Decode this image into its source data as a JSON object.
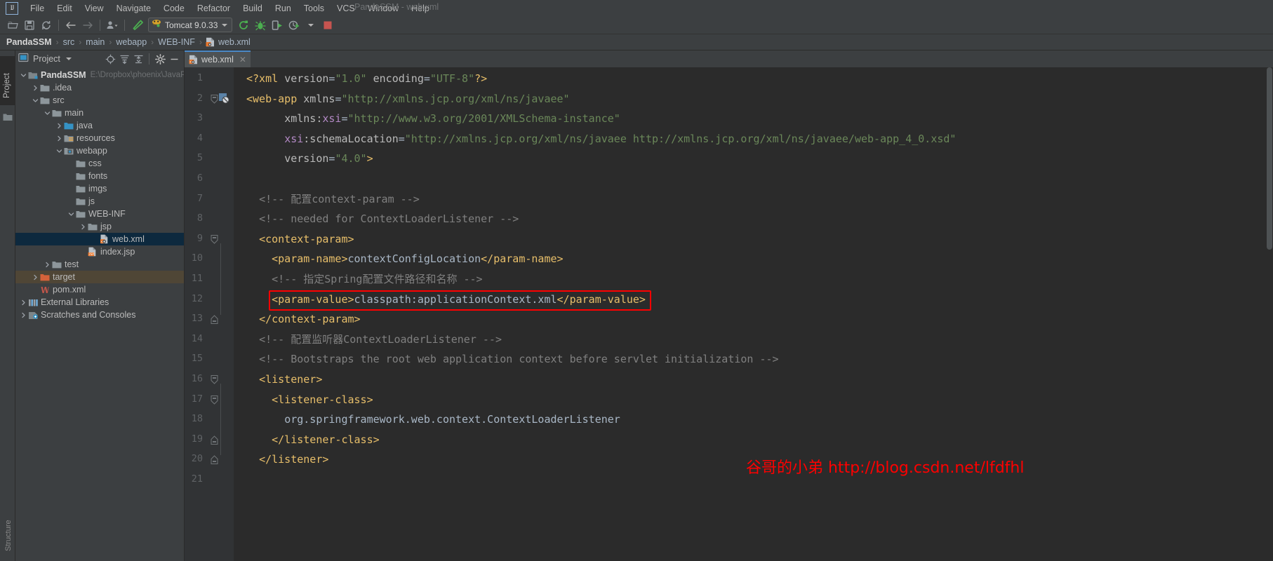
{
  "window": {
    "title": "PandaSSM - web.xml",
    "logo": "IJ"
  },
  "menubar": {
    "items": [
      {
        "label": "File",
        "mnemonic": "F"
      },
      {
        "label": "Edit",
        "mnemonic": "E"
      },
      {
        "label": "View",
        "mnemonic": "V"
      },
      {
        "label": "Navigate",
        "mnemonic": "N"
      },
      {
        "label": "Code",
        "mnemonic": "C"
      },
      {
        "label": "Refactor",
        "mnemonic": "R"
      },
      {
        "label": "Build",
        "mnemonic": "B"
      },
      {
        "label": "Run",
        "mnemonic": "R"
      },
      {
        "label": "Tools",
        "mnemonic": "T"
      },
      {
        "label": "VCS",
        "mnemonic": "V"
      },
      {
        "label": "Window",
        "mnemonic": "W"
      },
      {
        "label": "Help",
        "mnemonic": "H"
      }
    ]
  },
  "toolbar": {
    "open_icon": "open-folder-icon",
    "save_icon": "save-icon",
    "sync_icon": "sync-icon",
    "back_icon": "back-arrow-icon",
    "forward_icon": "forward-arrow-icon",
    "profile_icon": "user-profile-icon",
    "build_icon": "build-hammer-icon",
    "run_config": {
      "label": "Tomcat 9.0.33",
      "icon": "tomcat-icon",
      "dropdown_icon": "chevron-down-icon"
    },
    "rerun_icon": "rerun-icon",
    "debug_icon": "debug-bug-icon",
    "run_with_coverage_icon": "run-coverage-icon",
    "profile_run_icon": "profiler-run-icon",
    "stop_icon": "stop-square-icon"
  },
  "breadcrumb": {
    "items": [
      "PandaSSM",
      "src",
      "main",
      "webapp",
      "WEB-INF",
      "web.xml"
    ],
    "separator": "›"
  },
  "left_strip": {
    "project_tab": "Project",
    "structure_tab": "Structure",
    "favorites_icon": "favorites-folder-icon"
  },
  "project_panel": {
    "title": "Project",
    "title_dropdown_icon": "chevron-down-icon",
    "icons": [
      "locate-target-icon",
      "expand-all-icon",
      "collapse-all-icon",
      "settings-gear-icon",
      "hide-minus-icon"
    ],
    "tree": [
      {
        "label": "PandaSSM",
        "sub": "E:\\Dropbox\\phoenix\\JavaPro",
        "depth": 0,
        "arrow": "down",
        "icon": "module-icon",
        "bold": true,
        "state": "normal"
      },
      {
        "label": ".idea",
        "sub": "",
        "depth": 1,
        "arrow": "right",
        "icon": "folder-icon",
        "bold": false,
        "state": "normal"
      },
      {
        "label": "src",
        "sub": "",
        "depth": 1,
        "arrow": "down",
        "icon": "folder-icon",
        "bold": false,
        "state": "normal"
      },
      {
        "label": "main",
        "sub": "",
        "depth": 2,
        "arrow": "down",
        "icon": "folder-icon",
        "bold": false,
        "state": "normal"
      },
      {
        "label": "java",
        "sub": "",
        "depth": 3,
        "arrow": "right",
        "icon": "source-folder-icon",
        "bold": false,
        "state": "normal"
      },
      {
        "label": "resources",
        "sub": "",
        "depth": 3,
        "arrow": "right",
        "icon": "resources-folder-icon",
        "bold": false,
        "state": "normal"
      },
      {
        "label": "webapp",
        "sub": "",
        "depth": 3,
        "arrow": "down",
        "icon": "webapp-folder-icon",
        "bold": false,
        "state": "normal"
      },
      {
        "label": "css",
        "sub": "",
        "depth": 4,
        "arrow": "none",
        "icon": "folder-icon",
        "bold": false,
        "state": "normal"
      },
      {
        "label": "fonts",
        "sub": "",
        "depth": 4,
        "arrow": "none",
        "icon": "folder-icon",
        "bold": false,
        "state": "normal"
      },
      {
        "label": "imgs",
        "sub": "",
        "depth": 4,
        "arrow": "none",
        "icon": "folder-icon",
        "bold": false,
        "state": "normal"
      },
      {
        "label": "js",
        "sub": "",
        "depth": 4,
        "arrow": "none",
        "icon": "folder-icon",
        "bold": false,
        "state": "normal"
      },
      {
        "label": "WEB-INF",
        "sub": "",
        "depth": 4,
        "arrow": "down",
        "icon": "folder-icon",
        "bold": false,
        "state": "normal"
      },
      {
        "label": "jsp",
        "sub": "",
        "depth": 5,
        "arrow": "right",
        "icon": "folder-icon",
        "bold": false,
        "state": "normal"
      },
      {
        "label": "web.xml",
        "sub": "",
        "depth": 6,
        "arrow": "none",
        "icon": "xml-file-icon",
        "bold": false,
        "state": "selected"
      },
      {
        "label": "index.jsp",
        "sub": "",
        "depth": 5,
        "arrow": "none",
        "icon": "jsp-file-icon",
        "bold": false,
        "state": "normal"
      },
      {
        "label": "test",
        "sub": "",
        "depth": 2,
        "arrow": "right",
        "icon": "folder-icon",
        "bold": false,
        "state": "normal"
      },
      {
        "label": "target",
        "sub": "",
        "depth": 1,
        "arrow": "right",
        "icon": "excluded-folder-icon",
        "bold": false,
        "state": "target"
      },
      {
        "label": "pom.xml",
        "sub": "",
        "depth": 1,
        "arrow": "none",
        "icon": "maven-file-icon",
        "bold": false,
        "state": "normal"
      },
      {
        "label": "External Libraries",
        "sub": "",
        "depth": 0,
        "arrow": "right",
        "icon": "libraries-icon",
        "bold": false,
        "state": "normal"
      },
      {
        "label": "Scratches and Consoles",
        "sub": "",
        "depth": 0,
        "arrow": "right",
        "icon": "scratches-icon",
        "bold": false,
        "state": "normal"
      }
    ]
  },
  "editor": {
    "tab": {
      "label": "web.xml",
      "icon": "xml-file-icon",
      "close_icon": "close-icon"
    },
    "first_line": 1,
    "lines": [
      {
        "num": 1,
        "fold": "none",
        "gicon": "none",
        "indent": 0,
        "segments": [
          {
            "t": "<?xml ",
            "c": "pi"
          },
          {
            "t": "version",
            "c": "attr"
          },
          {
            "t": "=",
            "c": "txt"
          },
          {
            "t": "\"1.0\"",
            "c": "str"
          },
          {
            "t": " ",
            "c": "txt"
          },
          {
            "t": "encoding",
            "c": "attr"
          },
          {
            "t": "=",
            "c": "txt"
          },
          {
            "t": "\"UTF-8\"",
            "c": "str"
          },
          {
            "t": "?>",
            "c": "pi"
          }
        ]
      },
      {
        "num": 2,
        "fold": "open",
        "gicon": "xml-schema-icon",
        "indent": 0,
        "segments": [
          {
            "t": "<web-app",
            "c": "tag"
          },
          {
            "t": " ",
            "c": "txt"
          },
          {
            "t": "xmlns",
            "c": "attr"
          },
          {
            "t": "=",
            "c": "txt"
          },
          {
            "t": "\"http://xmlns.jcp.org/xml/ns/javaee\"",
            "c": "str"
          }
        ]
      },
      {
        "num": 3,
        "fold": "none",
        "gicon": "none",
        "indent": 6,
        "segments": [
          {
            "t": "xmlns:",
            "c": "attr"
          },
          {
            "t": "xsi",
            "c": "ns"
          },
          {
            "t": "=",
            "c": "txt"
          },
          {
            "t": "\"http://www.w3.org/2001/XMLSchema-instance\"",
            "c": "str"
          }
        ]
      },
      {
        "num": 4,
        "fold": "none",
        "gicon": "none",
        "indent": 6,
        "segments": [
          {
            "t": "xsi",
            "c": "ns"
          },
          {
            "t": ":schemaLocation",
            "c": "attr"
          },
          {
            "t": "=",
            "c": "txt"
          },
          {
            "t": "\"http://xmlns.jcp.org/xml/ns/javaee http://xmlns.jcp.org/xml/ns/javaee/web-app_4_0.xsd\"",
            "c": "str"
          }
        ]
      },
      {
        "num": 5,
        "fold": "none",
        "gicon": "none",
        "indent": 6,
        "segments": [
          {
            "t": "version",
            "c": "attr"
          },
          {
            "t": "=",
            "c": "txt"
          },
          {
            "t": "\"4.0\"",
            "c": "str"
          },
          {
            "t": ">",
            "c": "tag"
          }
        ]
      },
      {
        "num": 6,
        "fold": "none",
        "gicon": "none",
        "indent": 0,
        "segments": []
      },
      {
        "num": 7,
        "fold": "none",
        "gicon": "none",
        "indent": 2,
        "segments": [
          {
            "t": "<!-- 配置context-param -->",
            "c": "cmt"
          }
        ]
      },
      {
        "num": 8,
        "fold": "none",
        "gicon": "none",
        "indent": 2,
        "segments": [
          {
            "t": "<!-- needed for ContextLoaderListener -->",
            "c": "cmt"
          }
        ]
      },
      {
        "num": 9,
        "fold": "open",
        "gicon": "none",
        "indent": 2,
        "segments": [
          {
            "t": "<context-param>",
            "c": "tag"
          }
        ]
      },
      {
        "num": 10,
        "fold": "none",
        "gicon": "none",
        "indent": 4,
        "segments": [
          {
            "t": "<param-name>",
            "c": "tag"
          },
          {
            "t": "contextConfigLocation",
            "c": "txt"
          },
          {
            "t": "</param-name>",
            "c": "tag"
          }
        ]
      },
      {
        "num": 11,
        "fold": "none",
        "gicon": "none",
        "indent": 4,
        "segments": [
          {
            "t": "<!-- 指定Spring配置文件路径和名称 -->",
            "c": "cmt"
          }
        ]
      },
      {
        "num": 12,
        "fold": "none",
        "gicon": "none",
        "indent": 4,
        "highlight": true,
        "segments": [
          {
            "t": "<param-value>",
            "c": "tag"
          },
          {
            "t": "classpath:applicationContext.xml",
            "c": "txt"
          },
          {
            "t": "</param-value>",
            "c": "tag"
          }
        ]
      },
      {
        "num": 13,
        "fold": "close",
        "gicon": "none",
        "indent": 2,
        "segments": [
          {
            "t": "</context-param>",
            "c": "tag"
          }
        ]
      },
      {
        "num": 14,
        "fold": "none",
        "gicon": "none",
        "indent": 2,
        "segments": [
          {
            "t": "<!-- 配置监听器ContextLoaderListener -->",
            "c": "cmt"
          }
        ]
      },
      {
        "num": 15,
        "fold": "none",
        "gicon": "none",
        "indent": 2,
        "segments": [
          {
            "t": "<!-- Bootstraps the root web application context before servlet initialization -->",
            "c": "cmt"
          }
        ]
      },
      {
        "num": 16,
        "fold": "open",
        "gicon": "none",
        "indent": 2,
        "segments": [
          {
            "t": "<listener>",
            "c": "tag"
          }
        ]
      },
      {
        "num": 17,
        "fold": "open",
        "gicon": "none",
        "indent": 4,
        "segments": [
          {
            "t": "<listener-class>",
            "c": "tag"
          }
        ]
      },
      {
        "num": 18,
        "fold": "none",
        "gicon": "none",
        "indent": 6,
        "segments": [
          {
            "t": "org.springframework.web.context.ContextLoaderListener",
            "c": "txt"
          }
        ]
      },
      {
        "num": 19,
        "fold": "close",
        "gicon": "none",
        "indent": 4,
        "segments": [
          {
            "t": "</listener-class>",
            "c": "tag"
          }
        ]
      },
      {
        "num": 20,
        "fold": "close",
        "gicon": "none",
        "indent": 2,
        "segments": [
          {
            "t": "</listener>",
            "c": "tag"
          }
        ]
      },
      {
        "num": 21,
        "fold": "none",
        "gicon": "none",
        "indent": 0,
        "segments": []
      }
    ]
  },
  "watermark": {
    "text": "谷哥的小弟 http://blog.csdn.net/lfdfhl",
    "color": "#ff0000"
  },
  "colors": {
    "background": "#2b2b2b",
    "chrome": "#3c3f41",
    "gutter": "#313335",
    "selection": "#0d293e",
    "target_row": "#4f4636",
    "tag": "#e8bf6a",
    "string": "#6a8759",
    "comment": "#808080",
    "text": "#a9b7c6",
    "namespace": "#b389c5",
    "highlight_box": "#ff0000",
    "tab_accent": "#4a88c7"
  }
}
